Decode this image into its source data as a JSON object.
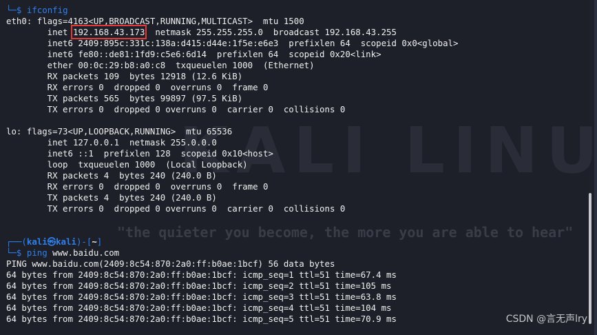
{
  "watermark": {
    "logo_text": "KALI LINUX",
    "tagline": "\"the quieter you become, the more you are able to hear\""
  },
  "prompt": {
    "corner_top": "┌──",
    "corner_bottom": "└─",
    "dollar": "$",
    "user_host_open": "(",
    "user": "kali",
    "at": "㉿",
    "host": "kali",
    "user_host_close": ")",
    "dash": "-[",
    "path": "~",
    "path_close": "]"
  },
  "ifconfig": {
    "command": "ifconfig",
    "eth0": {
      "header": "eth0: flags=4163<UP,BROADCAST,RUNNING,MULTICAST>  mtu 1500",
      "inet_prefix": "        inet ",
      "inet_ip": "192.168.43.173",
      "inet_suffix": "  netmask 255.255.255.0  broadcast 192.168.43.255",
      "inet6_global": "        inet6 2409:895c:331c:138a:d415:d44e:1f5e:e6e3  prefixlen 64  scopeid 0x0<global>",
      "inet6_link": "        inet6 fe80::de81:1fd9:c5e6:6d14  prefixlen 64  scopeid 0x20<link>",
      "ether": "        ether 00:0c:29:b8:a0:c8  txqueuelen 1000  (Ethernet)",
      "rx_packets": "        RX packets 109  bytes 12918 (12.6 KiB)",
      "rx_errors": "        RX errors 0  dropped 0  overruns 0  frame 0",
      "tx_packets": "        TX packets 565  bytes 99897 (97.5 KiB)",
      "tx_errors": "        TX errors 0  dropped 0 overruns 0  carrier 0  collisions 0"
    },
    "lo": {
      "header": "lo: flags=73<UP,LOOPBACK,RUNNING>  mtu 65536",
      "inet": "        inet 127.0.0.1  netmask 255.0.0.0",
      "inet6": "        inet6 ::1  prefixlen 128  scopeid 0x10<host>",
      "loop": "        loop  txqueuelen 1000  (Local Loopback)",
      "rx_packets": "        RX packets 4  bytes 240 (240.0 B)",
      "rx_errors": "        RX errors 0  dropped 0  overruns 0  frame 0",
      "tx_packets": "        TX packets 4  bytes 240 (240.0 B)",
      "tx_errors": "        TX errors 0  dropped 0 overruns 0  carrier 0  collisions 0"
    }
  },
  "ping": {
    "command": "ping",
    "arg": " www.baidu.com",
    "header": "PING www.baidu.com(2409:8c54:870:2a0:ff:b0ae:1bcf) 56 data bytes",
    "replies": [
      "64 bytes from 2409:8c54:870:2a0:ff:b0ae:1bcf: icmp_seq=1 ttl=51 time=67.4 ms",
      "64 bytes from 2409:8c54:870:2a0:ff:b0ae:1bcf: icmp_seq=2 ttl=51 time=105 ms",
      "64 bytes from 2409:8c54:870:2a0:ff:b0ae:1bcf: icmp_seq=3 ttl=51 time=63.8 ms",
      "64 bytes from 2409:8c54:870:2a0:ff:b0ae:1bcf: icmp_seq=4 ttl=51 time=104 ms",
      "64 bytes from 2409:8c54:870:2a0:ff:b0ae:1bcf: icmp_seq=5 ttl=51 time=70.9 ms"
    ]
  },
  "footer": {
    "csdn_watermark": "CSDN @言无声lry"
  },
  "colors": {
    "background": "#1e2029",
    "prompt_blue": "#2f80ed",
    "highlight_red": "#e53935",
    "text": "#f0f0f0"
  }
}
